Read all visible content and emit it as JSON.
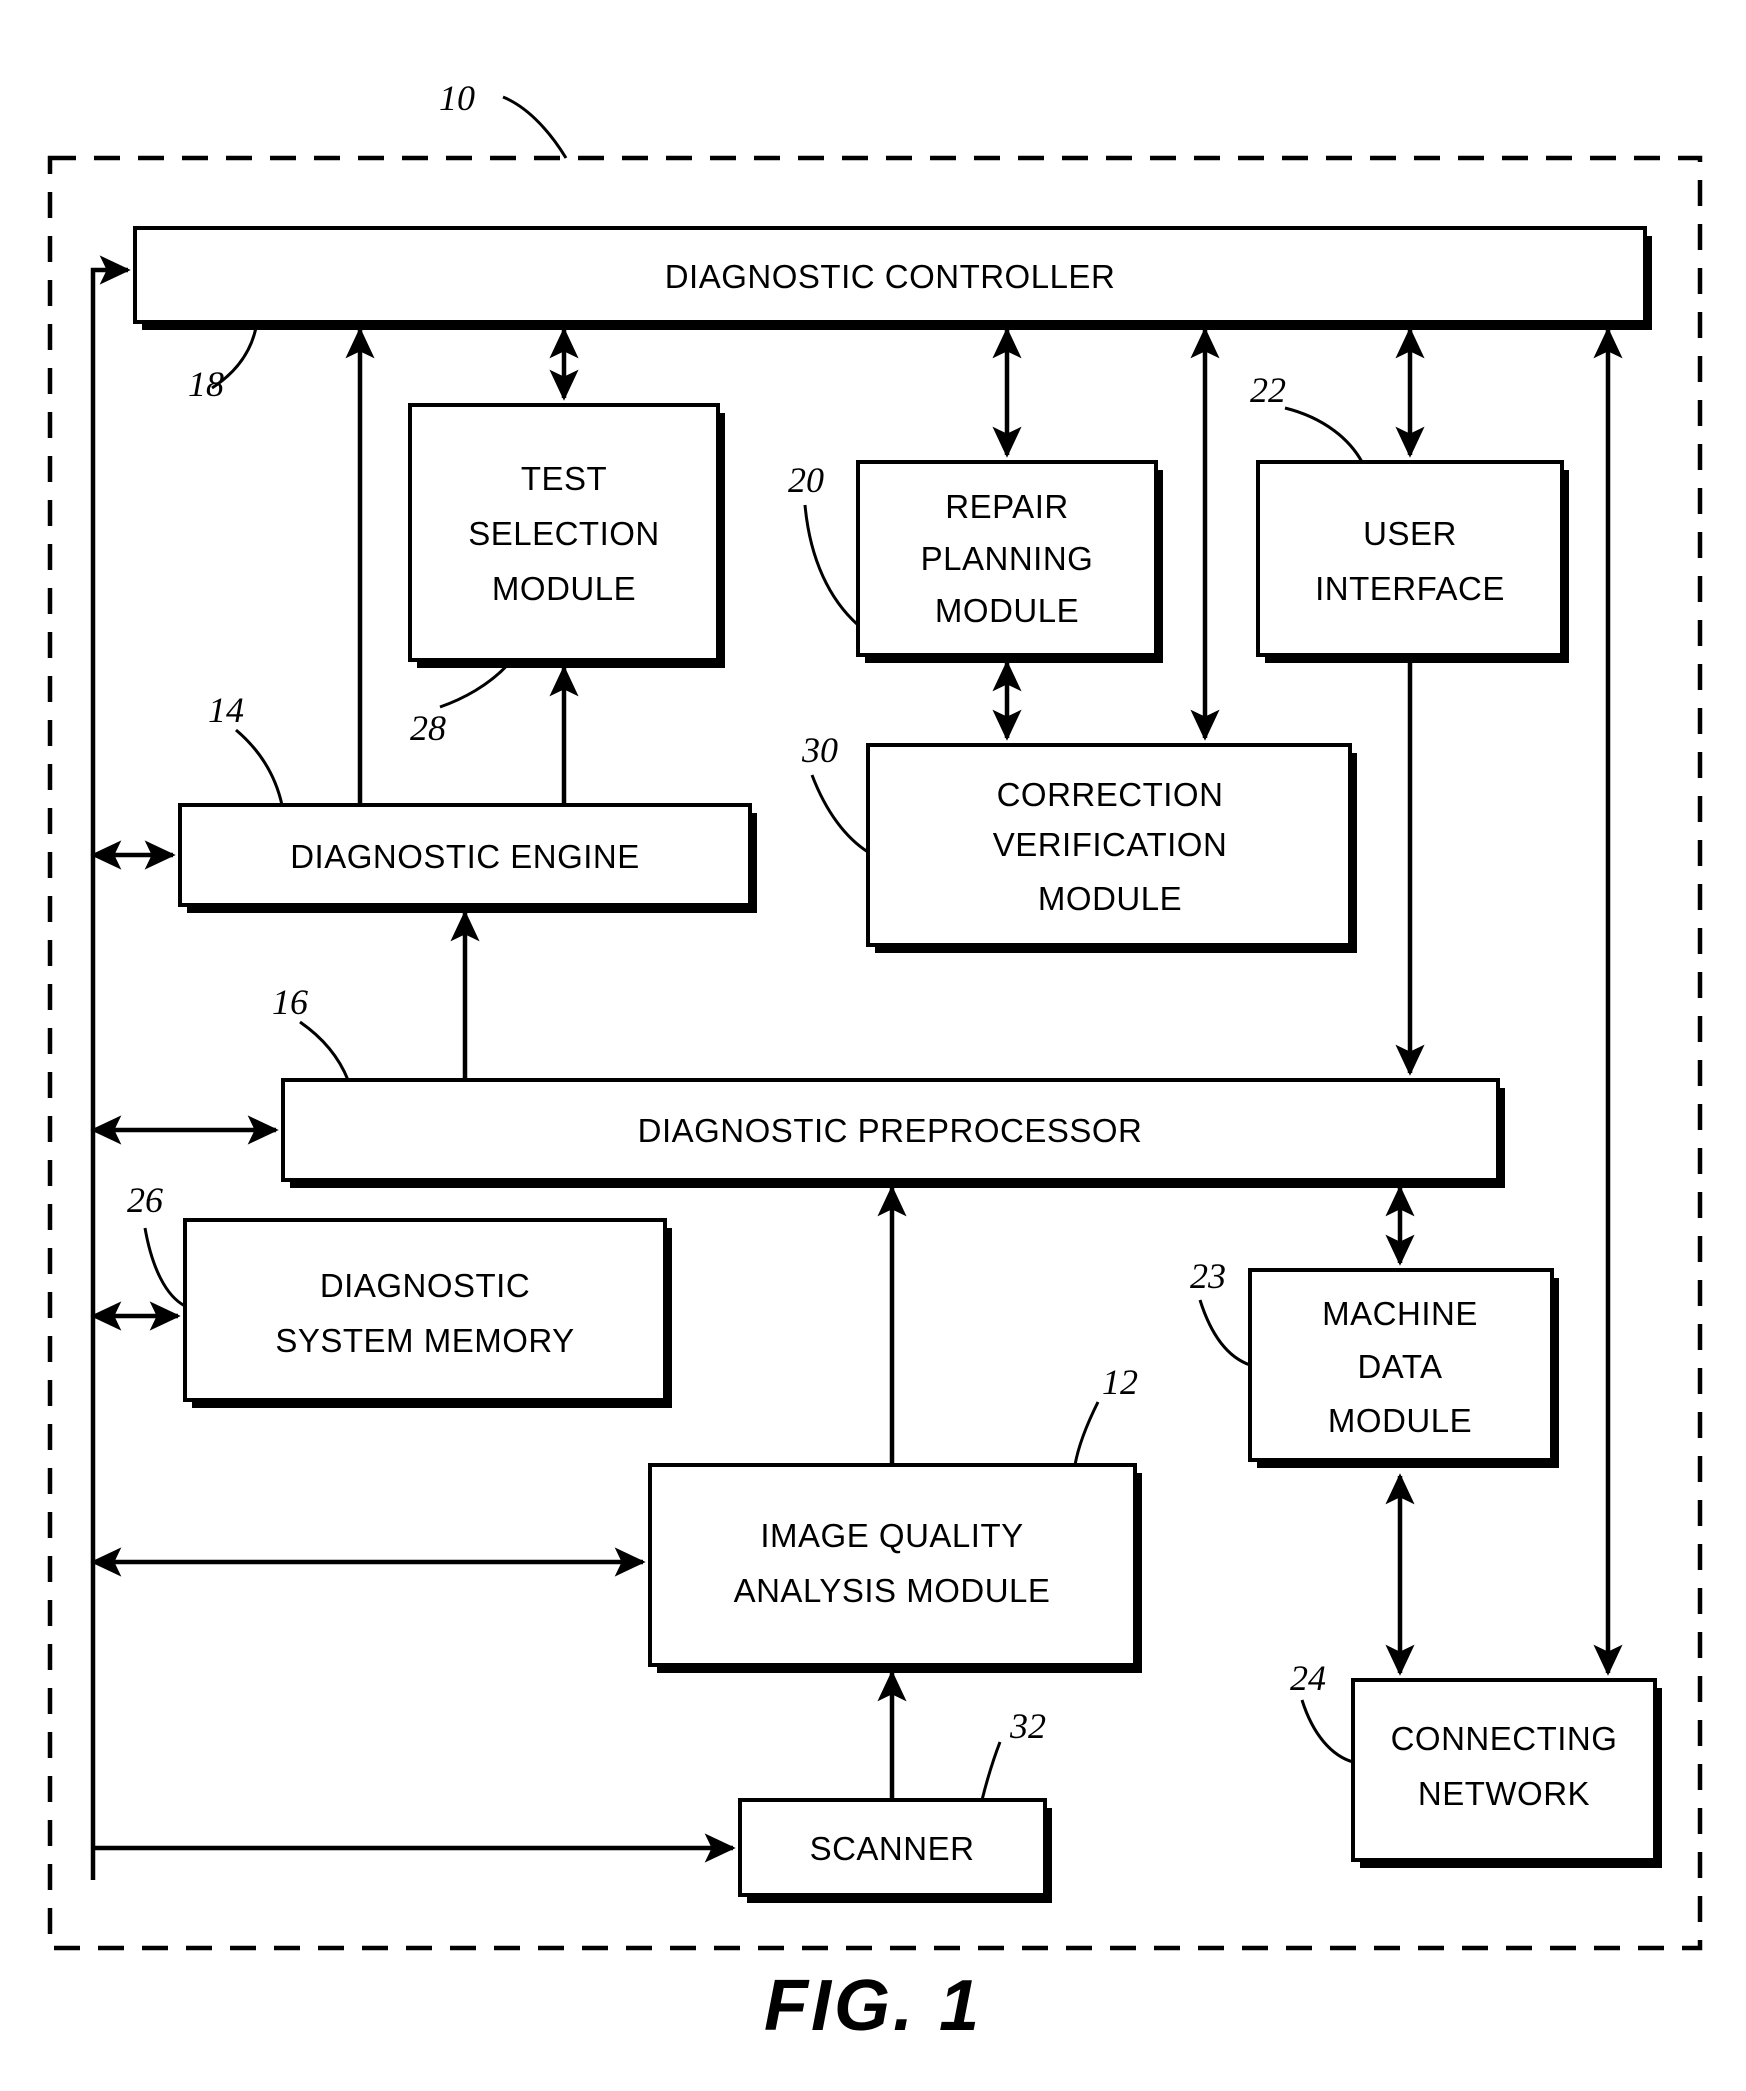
{
  "figure": {
    "caption": "FIG. 1",
    "system_ref": "10"
  },
  "blocks": [
    {
      "id": "diagnostic-controller",
      "label": "DIAGNOSTIC CONTROLLER",
      "lines": [
        "DIAGNOSTIC CONTROLLER"
      ],
      "ref": "18"
    },
    {
      "id": "test-selection-module",
      "label": "TEST SELECTION MODULE",
      "lines": [
        "TEST",
        "SELECTION",
        "MODULE"
      ],
      "ref": "28"
    },
    {
      "id": "repair-planning-module",
      "label": "REPAIR PLANNING MODULE",
      "lines": [
        "REPAIR",
        "PLANNING",
        "MODULE"
      ],
      "ref": "20"
    },
    {
      "id": "user-interface",
      "label": "USER INTERFACE",
      "lines": [
        "USER",
        "INTERFACE"
      ],
      "ref": "22"
    },
    {
      "id": "diagnostic-engine",
      "label": "DIAGNOSTIC ENGINE",
      "lines": [
        "DIAGNOSTIC ENGINE"
      ],
      "ref": "14"
    },
    {
      "id": "correction-verification-module",
      "label": "CORRECTION VERIFICATION MODULE",
      "lines": [
        "CORRECTION",
        "VERIFICATION",
        "MODULE"
      ],
      "ref": "30"
    },
    {
      "id": "diagnostic-preprocessor",
      "label": "DIAGNOSTIC PREPROCESSOR",
      "lines": [
        "DIAGNOSTIC PREPROCESSOR"
      ],
      "ref": "16"
    },
    {
      "id": "diagnostic-system-memory",
      "label": "DIAGNOSTIC SYSTEM MEMORY",
      "lines": [
        "DIAGNOSTIC",
        "SYSTEM MEMORY"
      ],
      "ref": "26"
    },
    {
      "id": "machine-data-module",
      "label": "MACHINE DATA MODULE",
      "lines": [
        "MACHINE",
        "DATA",
        "MODULE"
      ],
      "ref": "23"
    },
    {
      "id": "image-quality-analysis-module",
      "label": "IMAGE QUALITY ANALYSIS MODULE",
      "lines": [
        "IMAGE QUALITY",
        "ANALYSIS MODULE"
      ],
      "ref": "12"
    },
    {
      "id": "connecting-network",
      "label": "CONNECTING NETWORK",
      "lines": [
        "CONNECTING",
        "NETWORK"
      ],
      "ref": "24"
    },
    {
      "id": "scanner",
      "label": "SCANNER",
      "lines": [
        "SCANNER"
      ],
      "ref": "32"
    }
  ],
  "text": {
    "diagnostic_controller": "DIAGNOSTIC CONTROLLER",
    "test_1": "TEST",
    "test_2": "SELECTION",
    "test_3": "MODULE",
    "repair_1": "REPAIR",
    "repair_2": "PLANNING",
    "repair_3": "MODULE",
    "ui_1": "USER",
    "ui_2": "INTERFACE",
    "diagnostic_engine": "DIAGNOSTIC ENGINE",
    "corr_1": "CORRECTION",
    "corr_2": "VERIFICATION",
    "corr_3": "MODULE",
    "diagnostic_preprocessor": "DIAGNOSTIC PREPROCESSOR",
    "mem_1": "DIAGNOSTIC",
    "mem_2": "SYSTEM MEMORY",
    "mdm_1": "MACHINE",
    "mdm_2": "DATA",
    "mdm_3": "MODULE",
    "iqam_1": "IMAGE QUALITY",
    "iqam_2": "ANALYSIS MODULE",
    "net_1": "CONNECTING",
    "net_2": "NETWORK",
    "scanner": "SCANNER",
    "caption": "FIG. 1"
  },
  "ref_numbers": {
    "system": "10",
    "image_quality_analysis_module": "12",
    "diagnostic_engine": "14",
    "diagnostic_preprocessor": "16",
    "diagnostic_controller": "18",
    "repair_planning_module": "20",
    "user_interface": "22",
    "machine_data_module": "23",
    "connecting_network": "24",
    "diagnostic_system_memory": "26",
    "test_selection_module": "28",
    "correction_verification_module": "30",
    "scanner": "32"
  },
  "colors": {
    "ink": "#000000",
    "paper": "#ffffff"
  }
}
